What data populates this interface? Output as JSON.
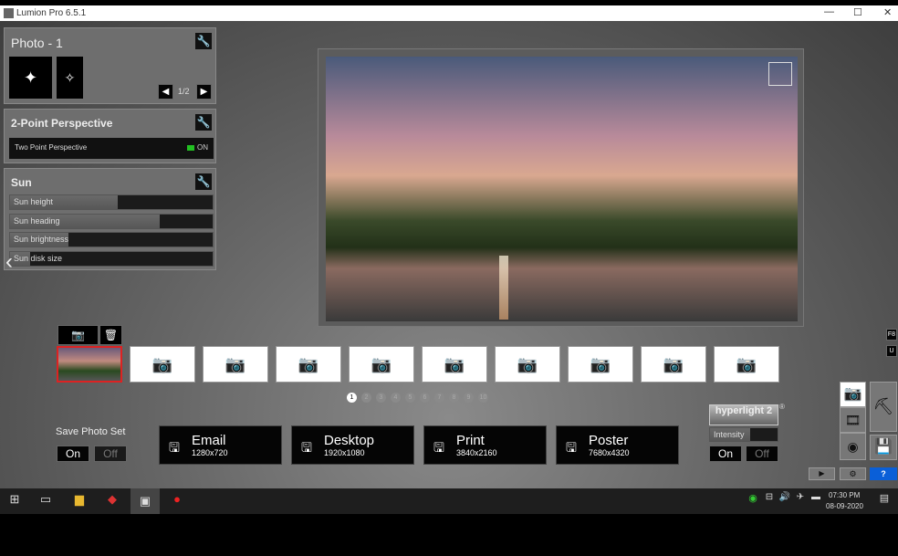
{
  "window": {
    "title": "Lumion Pro 6.5.1",
    "minimize": "—",
    "maximize": "☐",
    "close": "✕"
  },
  "photo_panel": {
    "title": "Photo - 1",
    "page": "1/2",
    "prev": "◀",
    "next": "▶"
  },
  "perspective_panel": {
    "title": "2-Point Perspective",
    "option_label": "Two Point Perspective",
    "option_state": "ON",
    "state_color": "#22c022"
  },
  "sun_panel": {
    "title": "Sun",
    "sliders": [
      {
        "label": "Sun height",
        "value": 0.53
      },
      {
        "label": "Sun heading",
        "value": 0.74
      },
      {
        "label": "Sun brightness",
        "value": 0.29
      },
      {
        "label": "Sun disk size",
        "value": 0.1
      }
    ]
  },
  "photo_slots": {
    "count": 10,
    "selected": 1
  },
  "pages": [
    "1",
    "2",
    "3",
    "4",
    "5",
    "6",
    "7",
    "8",
    "9",
    "10"
  ],
  "save_photo_set": {
    "label": "Save Photo Set",
    "on": "On",
    "off": "Off"
  },
  "save_buttons": [
    {
      "label": "Email",
      "size": "1280x720"
    },
    {
      "label": "Desktop",
      "size": "1920x1080"
    },
    {
      "label": "Print",
      "size": "3840x2160"
    },
    {
      "label": "Poster",
      "size": "7680x4320"
    }
  ],
  "hyperlight": {
    "logo": "hyperlight 2",
    "reg": "®",
    "intensity": "Intensity",
    "intensity_value": 0.6,
    "on": "On",
    "off": "Off"
  },
  "keys": {
    "f8": "F8",
    "u": "U"
  },
  "help": "?",
  "clock": {
    "time": "07:30 PM",
    "date": "08-09-2020"
  }
}
